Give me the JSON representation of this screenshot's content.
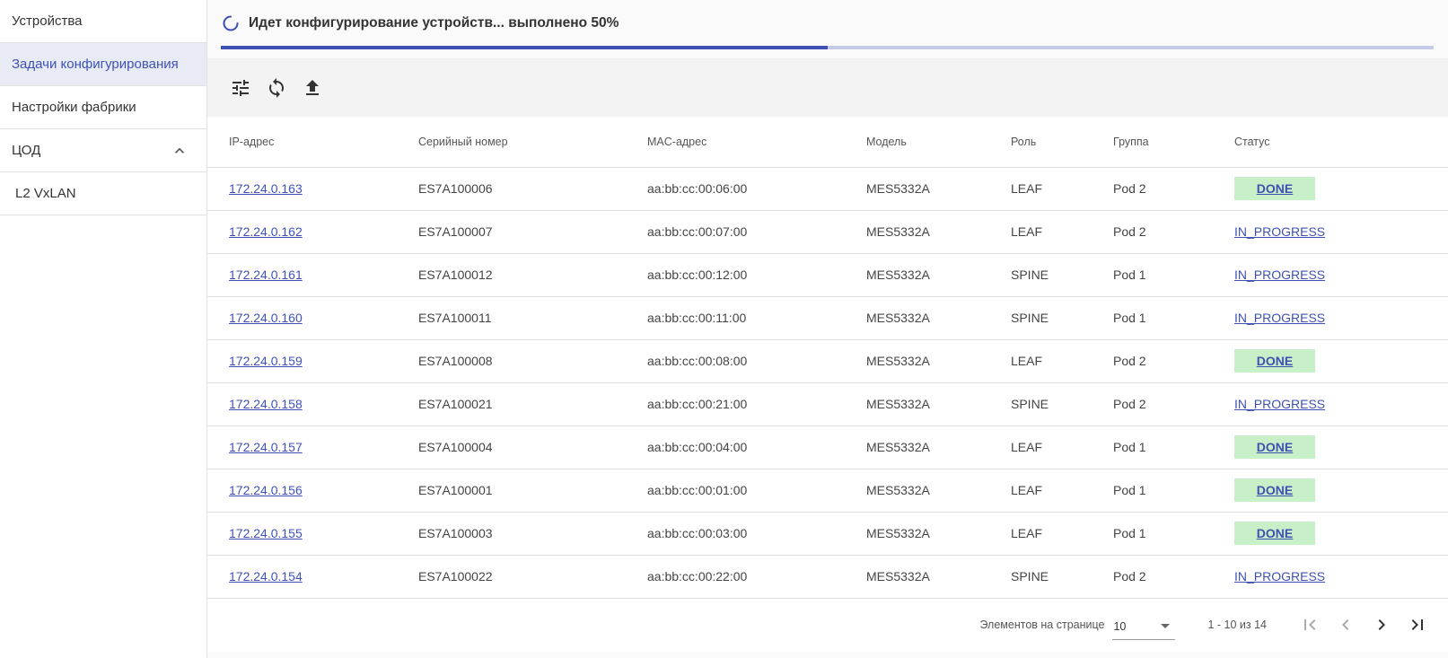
{
  "sidebar": {
    "items": [
      {
        "label": "Устройства",
        "active": false
      },
      {
        "label": "Задачи конфигурирования",
        "active": true
      },
      {
        "label": "Настройки фабрики",
        "active": false
      },
      {
        "label": "ЦОД",
        "active": false,
        "expanded": true
      },
      {
        "label": "L2 VxLAN",
        "active": false,
        "sub": true
      }
    ]
  },
  "progress": {
    "title": "Идет конфигурирование устройств... выполнено 50%",
    "percent": 50,
    "color": "#3f51b5"
  },
  "toolbar": {
    "icons": [
      "tune-icon",
      "sync-icon",
      "upload-icon"
    ]
  },
  "table": {
    "headers": [
      "IP-адрес",
      "Серийный номер",
      "MAC-адрес",
      "Модель",
      "Роль",
      "Группа",
      "Статус"
    ],
    "rows": [
      {
        "ip": "172.24.0.163",
        "serial": "ES7A100006",
        "mac": "aa:bb:cc:00:06:00",
        "model": "MES5332A",
        "role": "LEAF",
        "group": "Pod 2",
        "status": "DONE"
      },
      {
        "ip": "172.24.0.162",
        "serial": "ES7A100007",
        "mac": "aa:bb:cc:00:07:00",
        "model": "MES5332A",
        "role": "LEAF",
        "group": "Pod 2",
        "status": "IN_PROGRESS"
      },
      {
        "ip": "172.24.0.161",
        "serial": "ES7A100012",
        "mac": "aa:bb:cc:00:12:00",
        "model": "MES5332A",
        "role": "SPINE",
        "group": "Pod 1",
        "status": "IN_PROGRESS"
      },
      {
        "ip": "172.24.0.160",
        "serial": "ES7A100011",
        "mac": "aa:bb:cc:00:11:00",
        "model": "MES5332A",
        "role": "SPINE",
        "group": "Pod 1",
        "status": "IN_PROGRESS"
      },
      {
        "ip": "172.24.0.159",
        "serial": "ES7A100008",
        "mac": "aa:bb:cc:00:08:00",
        "model": "MES5332A",
        "role": "LEAF",
        "group": "Pod 2",
        "status": "DONE"
      },
      {
        "ip": "172.24.0.158",
        "serial": "ES7A100021",
        "mac": "aa:bb:cc:00:21:00",
        "model": "MES5332A",
        "role": "SPINE",
        "group": "Pod 2",
        "status": "IN_PROGRESS"
      },
      {
        "ip": "172.24.0.157",
        "serial": "ES7A100004",
        "mac": "aa:bb:cc:00:04:00",
        "model": "MES5332A",
        "role": "LEAF",
        "group": "Pod 1",
        "status": "DONE"
      },
      {
        "ip": "172.24.0.156",
        "serial": "ES7A100001",
        "mac": "aa:bb:cc:00:01:00",
        "model": "MES5332A",
        "role": "LEAF",
        "group": "Pod 1",
        "status": "DONE"
      },
      {
        "ip": "172.24.0.155",
        "serial": "ES7A100003",
        "mac": "aa:bb:cc:00:03:00",
        "model": "MES5332A",
        "role": "LEAF",
        "group": "Pod 1",
        "status": "DONE"
      },
      {
        "ip": "172.24.0.154",
        "serial": "ES7A100022",
        "mac": "aa:bb:cc:00:22:00",
        "model": "MES5332A",
        "role": "SPINE",
        "group": "Pod 2",
        "status": "IN_PROGRESS"
      }
    ]
  },
  "paginator": {
    "page_size_label": "Элементов на странице",
    "page_size": "10",
    "range": "1 - 10 из 14"
  }
}
